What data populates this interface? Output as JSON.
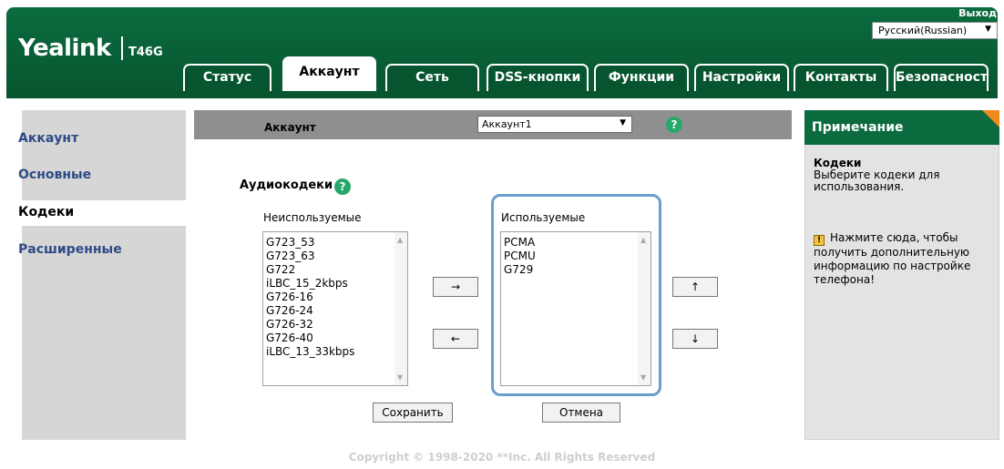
{
  "header": {
    "logo": "Yealink",
    "model": "T46G",
    "logout": "Выход",
    "language": "Русский(Russian)"
  },
  "tabs": [
    {
      "label": "Статус"
    },
    {
      "label": "Аккаунт"
    },
    {
      "label": "Сеть"
    },
    {
      "label": "DSS-кнопки"
    },
    {
      "label": "Функции"
    },
    {
      "label": "Настройки"
    },
    {
      "label": "Контакты"
    },
    {
      "label": "Безопасность"
    }
  ],
  "sidebar": {
    "items": [
      {
        "label": "Аккаунт"
      },
      {
        "label": "Основные"
      },
      {
        "label": "Кодеки"
      },
      {
        "label": "Расширенные"
      }
    ]
  },
  "main": {
    "bar_label": "Аккаунт",
    "account_selected": "Аккаунт1",
    "help_glyph": "?",
    "section_title": "Аудиокодеки",
    "unused_label": "Неиспользуемые",
    "used_label": "Используемые",
    "unused_codecs": [
      "G723_53",
      "G723_63",
      "G722",
      "iLBC_15_2kbps",
      "G726-16",
      "G726-24",
      "G726-32",
      "G726-40",
      "iLBC_13_33kbps"
    ],
    "used_codecs": [
      "PCMA",
      "PCMU",
      "G729"
    ],
    "move_right": "→",
    "move_left": "←",
    "move_up": "↑",
    "move_down": "↓",
    "save": "Сохранить",
    "cancel": "Отмена"
  },
  "note": {
    "heading": "Примечание",
    "title": "Кодеки",
    "text": "Выберите кодеки для использования.",
    "link_text": "Нажмите сюда, чтобы получить дополнительную информацию по настройке телефона!"
  },
  "footer": "Copyright © 1998-2020 **Inc. All Rights Reserved"
}
